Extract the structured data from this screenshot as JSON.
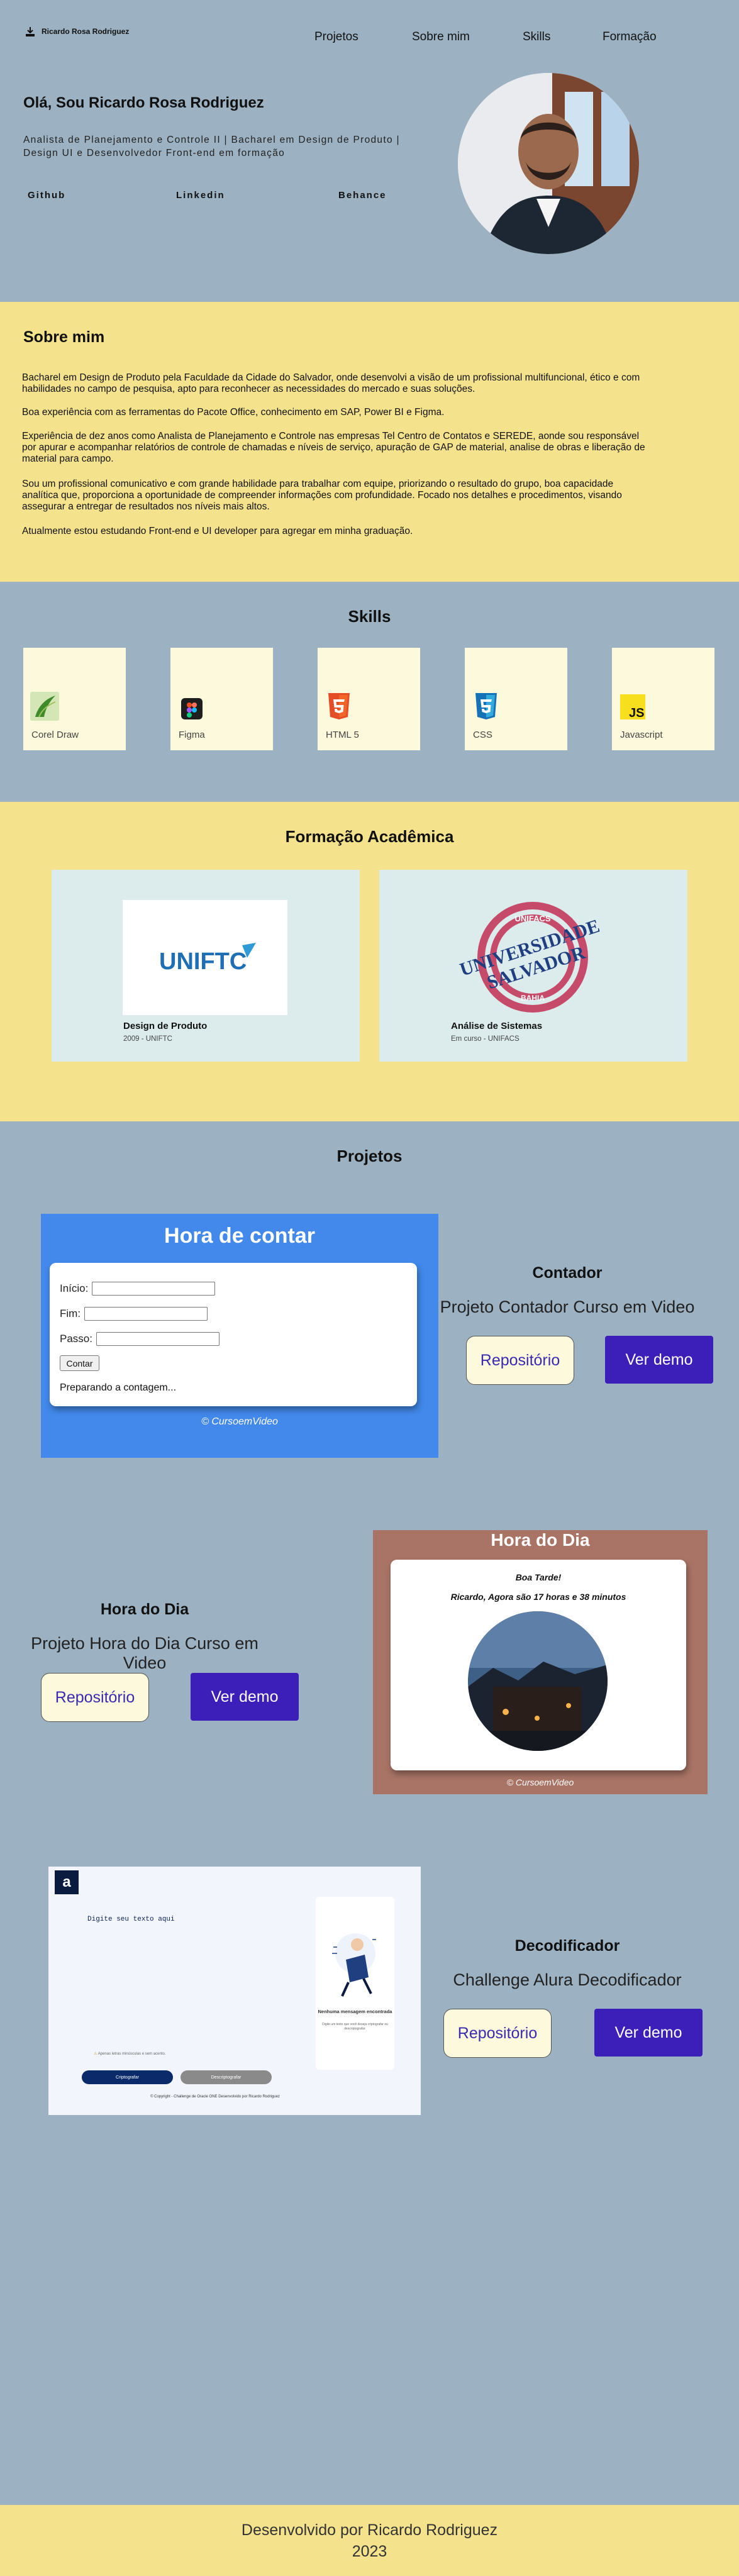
{
  "header": {
    "brand": "Ricardo Rosa Rodriguez",
    "nav": [
      "Projetos",
      "Sobre mim",
      "Skills",
      "Formação"
    ],
    "greeting": "Olá, Sou Ricardo Rosa Rodriguez",
    "subtitle": "Analista de Planejamento e Controle II | Bacharel em Design de Produto | Design UI e Desenvolvedor Front-end em formação",
    "social": [
      "Github",
      "Linkedin",
      "Behance"
    ]
  },
  "about": {
    "title": "Sobre mim",
    "paragraphs": [
      "Bacharel em Design de Produto pela Faculdade da Cidade do Salvador, onde desenvolvi a visão de um profissional multifuncional, ético e com habilidades no campo de pesquisa, apto para reconhecer as necessidades do mercado e suas soluções.",
      "Boa experiência com as ferramentas do Pacote Office, conhecimento em SAP, Power BI e Figma.",
      "Experiência de dez anos como Analista de Planejamento e Controle nas empresas Tel Centro de Contatos e SEREDE, aonde sou responsável por apurar e acompanhar relatórios de controle de chamadas e níveis de serviço, apuração de GAP de material, analise de obras e liberação de material para campo.",
      "Sou um profissional comunicativo e com grande habilidade para trabalhar com equipe, priorizando o resultado do grupo, boa capacidade analítica que, proporciona a oportunidade de compreender informações com profundidade. Focado nos detalhes e procedimentos, visando assegurar a entregar de resultados nos níveis mais altos.",
      "Atualmente estou estudando Front-end e UI developer para agregar em minha graduação."
    ]
  },
  "skills": {
    "title": "Skills",
    "items": [
      {
        "label": "Corel Draw",
        "icon": "coreldraw-icon"
      },
      {
        "label": "Figma",
        "icon": "figma-icon"
      },
      {
        "label": "HTML 5",
        "icon": "html5-icon"
      },
      {
        "label": "CSS",
        "icon": "css3-icon"
      },
      {
        "label": "Javascript",
        "icon": "javascript-icon"
      }
    ]
  },
  "education": {
    "title": "Formação Acadêmica",
    "items": [
      {
        "title": "Design de Produto",
        "meta": "2009 - UNIFTC",
        "logo": "UNIFTC"
      },
      {
        "title": "Análise de Sistemas",
        "meta": "Em curso - UNIFACS",
        "logo_top": "UNIFACS",
        "logo_main1": "UNIVERSIDADE",
        "logo_main2": "SALVADOR",
        "logo_bottom": "BAHIA"
      }
    ]
  },
  "projects": {
    "title": "Projetos",
    "items": [
      {
        "title": "Contador",
        "subtitle": "Projeto Contador Curso em Video",
        "repo": "Repositório",
        "demo": "Ver demo",
        "preview": {
          "title": "Hora de contar",
          "fields": [
            "Início:",
            "Fim:",
            "Passo:"
          ],
          "button": "Contar",
          "status": "Preparando a contagem...",
          "footer": "© CursoemVideo"
        }
      },
      {
        "title": "Hora do Dia",
        "subtitle": "Projeto Hora do Dia Curso em Video",
        "repo": "Repositório",
        "demo": "Ver demo",
        "preview": {
          "title": "Hora do Dia",
          "greeting": "Boa Tarde!",
          "time": "Ricardo, Agora são 17 horas e 38 minutos",
          "footer": "© CursoemVideo"
        }
      },
      {
        "title": "Decodificador",
        "subtitle": "Challenge Alura Decodificador",
        "repo": "Repositório",
        "demo": "Ver demo",
        "preview": {
          "logo": "a",
          "placeholder": "Digite seu texto aqui",
          "empty_title": "Nenhuma mensagem encontrada",
          "empty_desc": "Digite um texto que você deseja criptografar ou descriptografar.",
          "warning": "Apenas letras minúsculas e sem acento.",
          "encrypt": "Criptografar",
          "decrypt": "Descriptografar",
          "credit": "© Copyright - Challenge de Oracle ONE Desenvolvido por Ricardo Rodriguez"
        }
      }
    ]
  },
  "footer": {
    "line1": "Desenvolvido por Ricardo Rodriguez",
    "line2": "2023"
  },
  "colors": {
    "slate": "#9cb1c1",
    "yellow": "#f4e38c",
    "cream": "#fcf9dc",
    "accent": "#3b1fb8"
  }
}
